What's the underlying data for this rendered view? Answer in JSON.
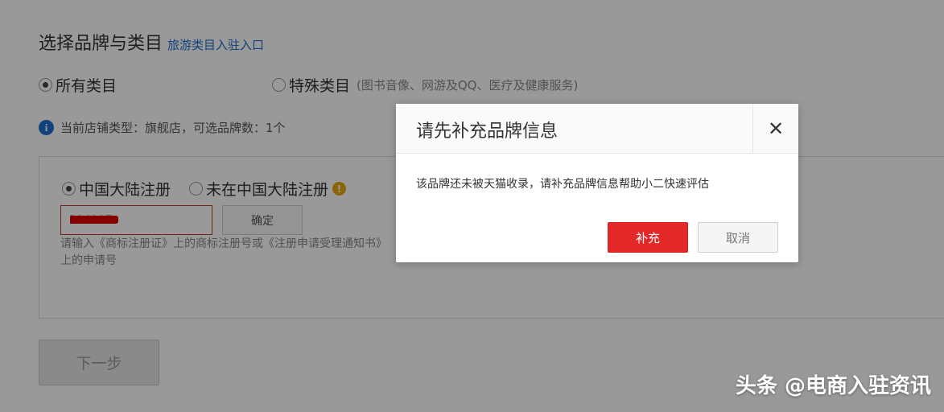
{
  "header": {
    "title": "选择品牌与类目",
    "travel_link": "旅游类目入驻入口"
  },
  "category": {
    "all_label": "所有类目",
    "special_label": "特殊类目",
    "special_desc": "(图书音像、网游及QQ、医疗及健康服务)",
    "selected": "all"
  },
  "store_info": {
    "icon": "info-icon",
    "text": "当前店铺类型：旗舰店，可选品牌数：1个"
  },
  "registration": {
    "mainland_label": "中国大陆注册",
    "non_mainland_label": "未在中国大陆注册",
    "warn_icon": "exclamation-icon",
    "selected": "mainland",
    "input_value": "294907",
    "confirm_label": "确定",
    "hint": "请输入《商标注册证》上的商标注册号或《注册申请受理通知书》上的申请号"
  },
  "next_button": "下一步",
  "dialog": {
    "title": "请先补充品牌信息",
    "close_icon": "close-icon",
    "message": "该品牌还未被天猫收录，请补充品牌信息帮助小二快速评估",
    "primary_label": "补充",
    "cancel_label": "取消"
  },
  "watermark": "头条 @电商入驻资讯",
  "colors": {
    "link": "#1f6fd1",
    "primary": "#e4282a",
    "warning": "#e8a80c"
  }
}
